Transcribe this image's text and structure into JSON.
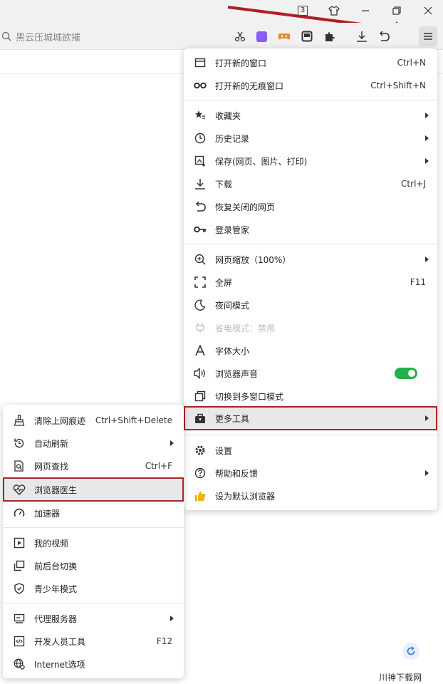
{
  "titlebar": {
    "tab_count": "3",
    "buttons": [
      "skin",
      "minimize",
      "restore",
      "close"
    ]
  },
  "toolbar": {
    "search_placeholder": "黑云压城城欲摧",
    "icons": [
      "scissors-icon",
      "extension-purple-icon",
      "game-icon",
      "reader-icon",
      "puzzle-icon",
      "download-icon",
      "undo-icon",
      "menu-icon"
    ]
  },
  "main_menu": {
    "items": [
      {
        "label": "打开新的窗口",
        "shortcut": "Ctrl+N"
      },
      {
        "label": "打开新的无痕窗口",
        "shortcut": "Ctrl+Shift+N"
      },
      {
        "label": "收藏夹"
      },
      {
        "label": "历史记录"
      },
      {
        "label": "保存(网页、图片、打印)"
      },
      {
        "label": "下载",
        "shortcut": "Ctrl+J"
      },
      {
        "label": "恢复关闭的网页"
      },
      {
        "label": "登录管家"
      },
      {
        "label": "网页缩放（100%）"
      },
      {
        "label": "全屏",
        "shortcut": "F11"
      },
      {
        "label": "夜间模式"
      },
      {
        "label": "省电模式：禁用"
      },
      {
        "label": "字体大小"
      },
      {
        "label": "浏览器声音",
        "toggle": "on"
      },
      {
        "label": "切换到多窗口模式"
      },
      {
        "label": "更多工具"
      },
      {
        "label": "设置"
      },
      {
        "label": "帮助和反馈"
      },
      {
        "label": "设为默认浏览器"
      }
    ]
  },
  "sub_menu": {
    "items": [
      {
        "label": "清除上网痕迹",
        "shortcut": "Ctrl+Shift+Delete"
      },
      {
        "label": "自动刷新"
      },
      {
        "label": "网页查找",
        "shortcut": "Ctrl+F"
      },
      {
        "label": "浏览器医生"
      },
      {
        "label": "加速器"
      },
      {
        "label": "我的视频"
      },
      {
        "label": "前后台切换"
      },
      {
        "label": "青少年模式"
      },
      {
        "label": "代理服务器"
      },
      {
        "label": "开发人员工具",
        "shortcut": "F12"
      },
      {
        "label": "Internet选项"
      }
    ]
  },
  "watermark": "川神下载网",
  "colors": {
    "accent_red": "#a8252a",
    "toggle_green": "#21b04a",
    "highlight_bg": "#e8e8e8"
  }
}
